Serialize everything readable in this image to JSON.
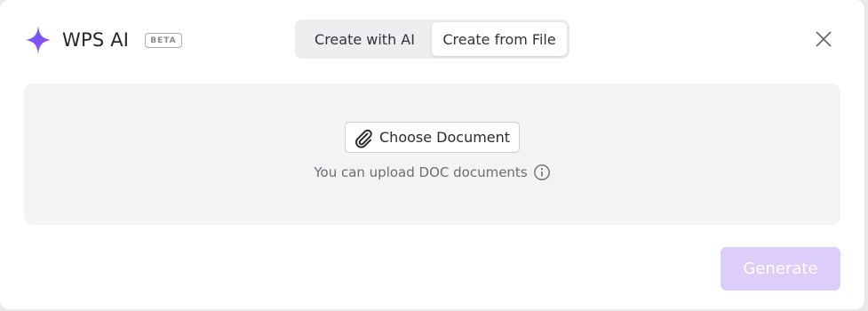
{
  "header": {
    "logo_icon": "sparkle-icon",
    "title": "WPS AI",
    "badge": "BETA",
    "close_icon": "close-icon"
  },
  "tabs": [
    {
      "label": "Create with AI",
      "active": false
    },
    {
      "label": "Create from File",
      "active": true
    }
  ],
  "upload": {
    "choose_button_label": "Choose Document",
    "choose_icon": "paperclip-icon",
    "hint": "You can upload DOC documents",
    "hint_icon": "info-icon"
  },
  "footer": {
    "generate_label": "Generate",
    "generate_enabled": false
  },
  "colors": {
    "accent_gradient": [
      "#4f6bff",
      "#b13cf5"
    ],
    "generate_disabled_bg": "#dccdfa",
    "panel_bg": "#f3f3f4"
  }
}
